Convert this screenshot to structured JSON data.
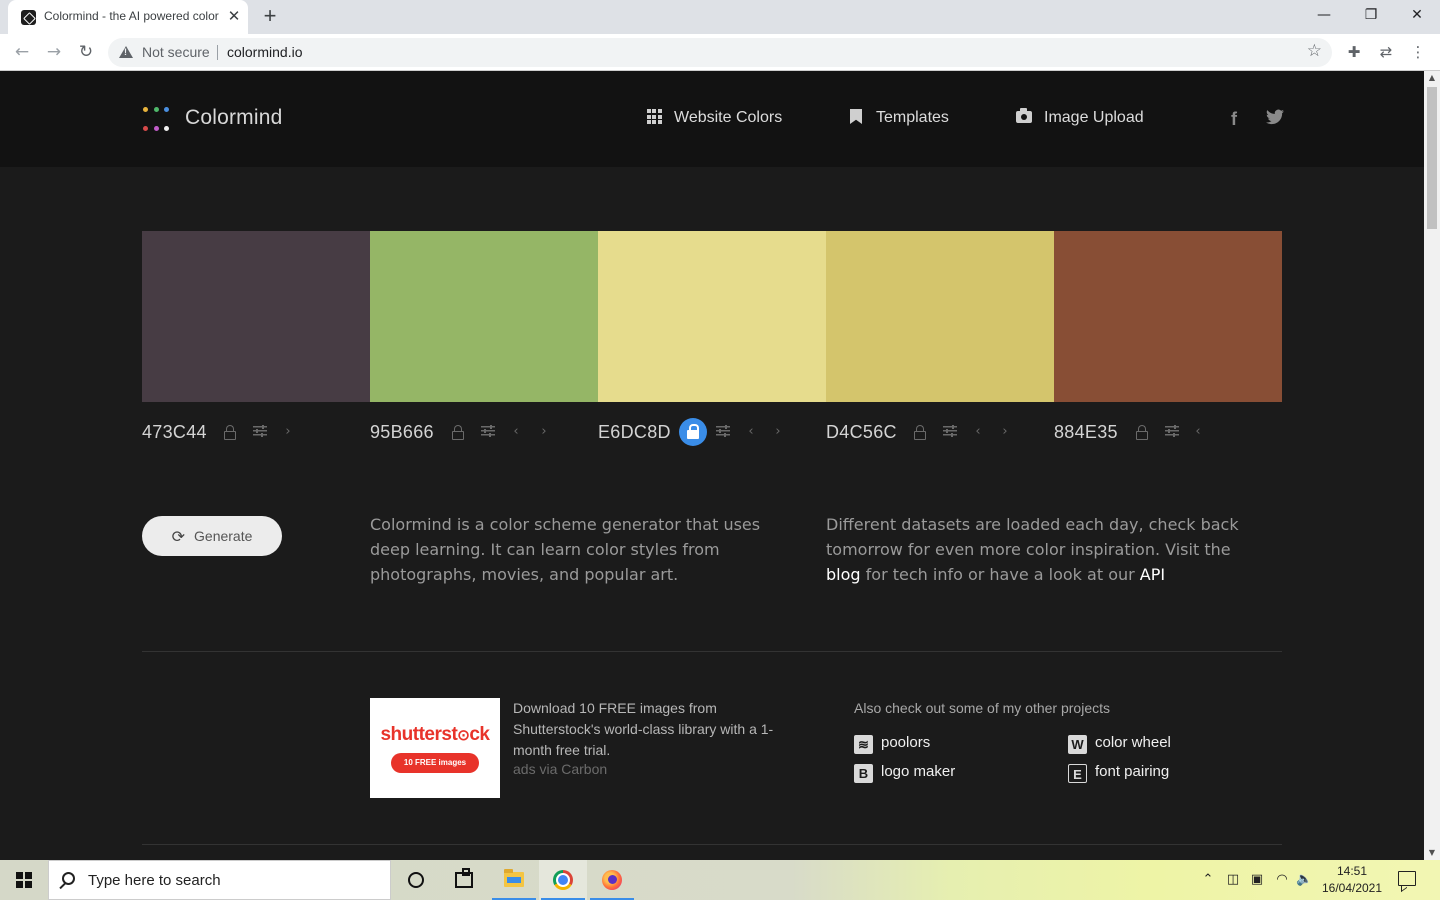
{
  "browser": {
    "tab_title": "Colormind - the AI powered color",
    "tab_close": "✕",
    "new_tab": "+",
    "not_secure": "Not secure",
    "url": "colormind.io",
    "window_controls": {
      "minimize": "—",
      "restore": "❐",
      "close": "✕"
    }
  },
  "site": {
    "brand": "Colormind",
    "nav": [
      {
        "label": "Website Colors",
        "icon": "grid-icon"
      },
      {
        "label": "Templates",
        "icon": "bookmark-icon"
      },
      {
        "label": "Image Upload",
        "icon": "camera-icon"
      }
    ],
    "social": {
      "facebook": "f",
      "twitter": "🐦"
    },
    "logo_colors": [
      "#e8b33c",
      "#4fb86a",
      "#4a8fe0",
      "#d64a4a",
      "#c05cc8",
      "#f0f0f0"
    ]
  },
  "palette": [
    {
      "hex": "473C44",
      "color": "#473C44",
      "locked": false
    },
    {
      "hex": "95B666",
      "color": "#95B666",
      "locked": false
    },
    {
      "hex": "E6DC8D",
      "color": "#E6DC8D",
      "locked": true
    },
    {
      "hex": "D4C56C",
      "color": "#D4C56C",
      "locked": false
    },
    {
      "hex": "884E35",
      "color": "#884E35",
      "locked": false
    }
  ],
  "controls": {
    "generate_label": "Generate",
    "prev_arrow": "‹",
    "next_arrow": "›"
  },
  "copy": {
    "intro": "Colormind is a color scheme generator that uses deep learning. It can learn color styles from photographs, movies, and popular art.",
    "datasets_prefix": "Different datasets are loaded each day, check back tomorrow for even more color inspiration. Visit the",
    "blog_link": "blog",
    "datasets_middle": "for tech info or have a look at our",
    "api_link": "API"
  },
  "ad": {
    "logo_text": "shutterstck",
    "badge": "10 FREE images",
    "text": "Download 10 FREE images from Shutterstock's world-class library with a 1-month free trial.",
    "via": "ads via Carbon"
  },
  "other_projects": {
    "title": "Also check out some of my other projects",
    "items": [
      {
        "label": "poolors",
        "icon": "poolors-icon"
      },
      {
        "label": "color wheel",
        "icon": "color-wheel-icon"
      },
      {
        "label": "logo maker",
        "icon": "logo-maker-icon"
      },
      {
        "label": "font pairing",
        "icon": "font-pairing-icon"
      }
    ]
  },
  "taskbar": {
    "search_placeholder": "Type here to search",
    "time": "14:51",
    "date": "16/04/2021"
  }
}
